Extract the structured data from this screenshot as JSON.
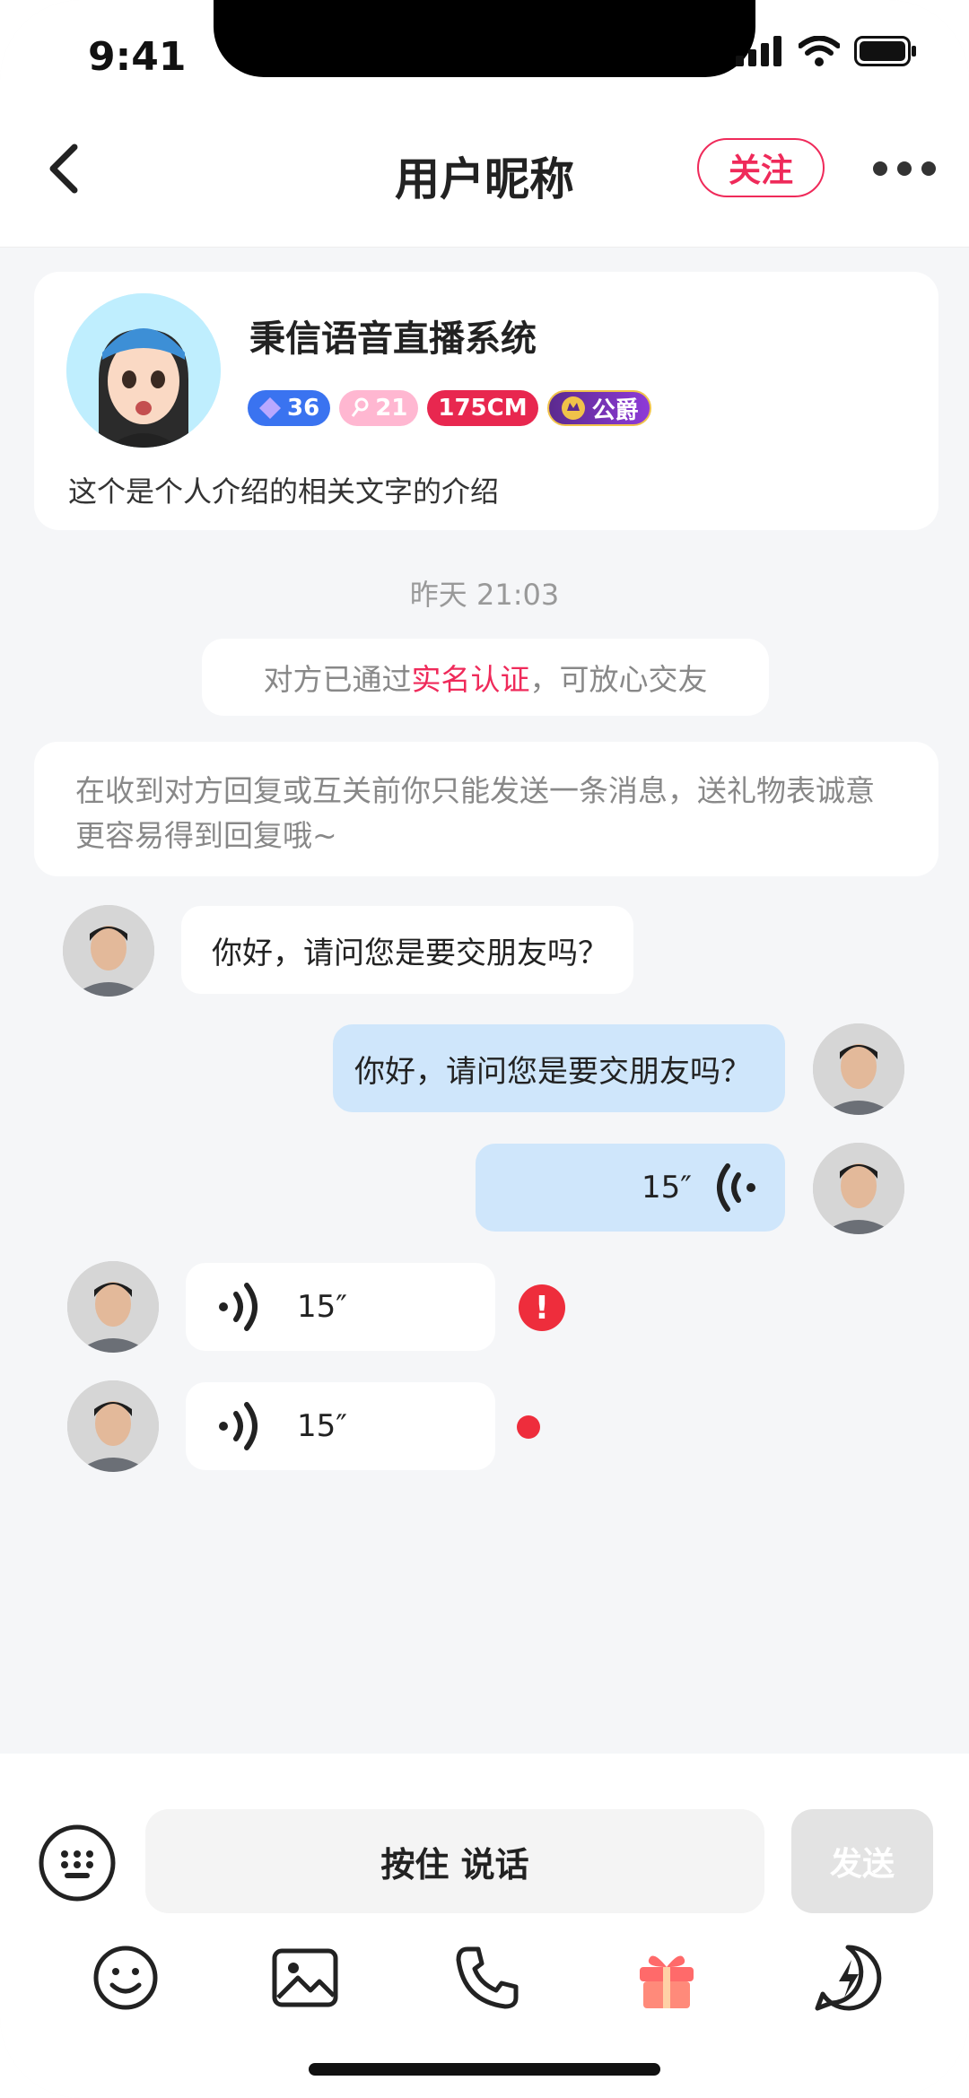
{
  "status": {
    "time": "9:41"
  },
  "nav": {
    "title": "用户昵称",
    "follow_label": "关注"
  },
  "profile": {
    "name": "秉信语音直播系统",
    "level": "36",
    "age": "21",
    "height": "175CM",
    "noble": "公爵",
    "bio": "这个是个人介绍的相关文字的介绍"
  },
  "chat": {
    "timestamp": "昨天 21:03",
    "verify_prefix": "对方已通过",
    "verify_highlight": "实名认证",
    "verify_suffix": "，可放心交友",
    "notice": "在收到对方回复或互关前你只能发送一条消息，送礼物表诚意更容易得到回复哦~",
    "messages": [
      {
        "side": "left",
        "type": "text",
        "text": "你好，请问您是要交朋友吗？"
      },
      {
        "side": "right",
        "type": "text",
        "text": "你好，请问您是要交朋友吗？"
      },
      {
        "side": "right",
        "type": "voice",
        "duration": "15″"
      },
      {
        "side": "left",
        "type": "voice",
        "duration": "15″",
        "status": "failed"
      },
      {
        "side": "left",
        "type": "voice",
        "duration": "15″",
        "status": "unread"
      }
    ]
  },
  "input": {
    "hold_label": "按住 说话",
    "send_label": "发送"
  },
  "toolbar": [
    "emoji-icon",
    "image-icon",
    "phone-icon",
    "gift-icon",
    "flash-chat-icon"
  ],
  "colors": {
    "accent": "#ef2a5a",
    "bubble_self": "#cfe6fb",
    "bg": "#f5f6f8",
    "alert": "#ee2d3c"
  }
}
